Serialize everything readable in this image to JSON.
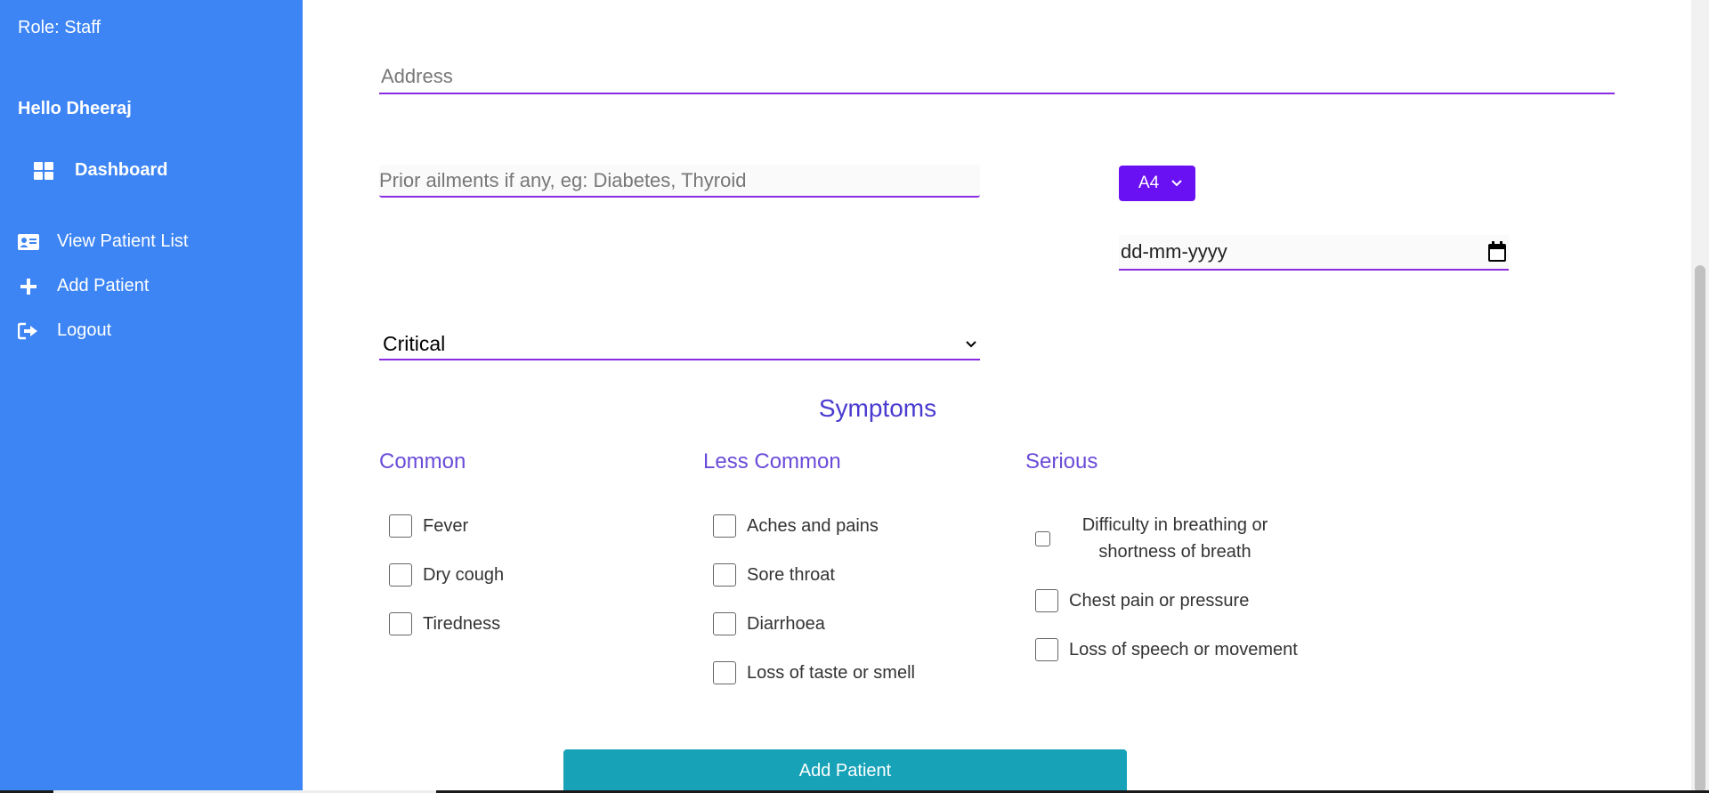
{
  "sidebar": {
    "role": "Role: Staff",
    "greeting": "Hello Dheeraj",
    "items": [
      {
        "label": "Dashboard",
        "icon": "dashboard-grid-icon"
      },
      {
        "label": "View Patient List",
        "icon": "id-card-icon"
      },
      {
        "label": "Add Patient",
        "icon": "plus-icon"
      },
      {
        "label": "Logout",
        "icon": "logout-icon"
      }
    ]
  },
  "form": {
    "address_placeholder": "Address",
    "ailments_placeholder": "Prior ailments if any, eg: Diabetes, Thyroid",
    "blood_group_value": "A4",
    "date_placeholder": "dd-mm-yyyy",
    "status_value": "Critical",
    "submit_label": "Add Patient"
  },
  "symptoms": {
    "title": "Symptoms",
    "common": {
      "heading": "Common",
      "items": [
        "Fever",
        "Dry cough",
        "Tiredness"
      ]
    },
    "less_common": {
      "heading": "Less Common",
      "items": [
        "Aches and pains",
        "Sore throat",
        "Diarrhoea",
        "Loss of taste or smell"
      ]
    },
    "serious": {
      "heading": "Serious",
      "items": [
        "Difficulty in breathing or shortness of breath",
        "Chest pain or pressure",
        "Loss of speech or movement"
      ]
    }
  },
  "colors": {
    "sidebar_bg": "#3d85f4",
    "field_underline": "#8a2be2",
    "blood_button": "#6a11f4",
    "heading": "#4a3bd0",
    "submit_button": "#17a2b8"
  }
}
